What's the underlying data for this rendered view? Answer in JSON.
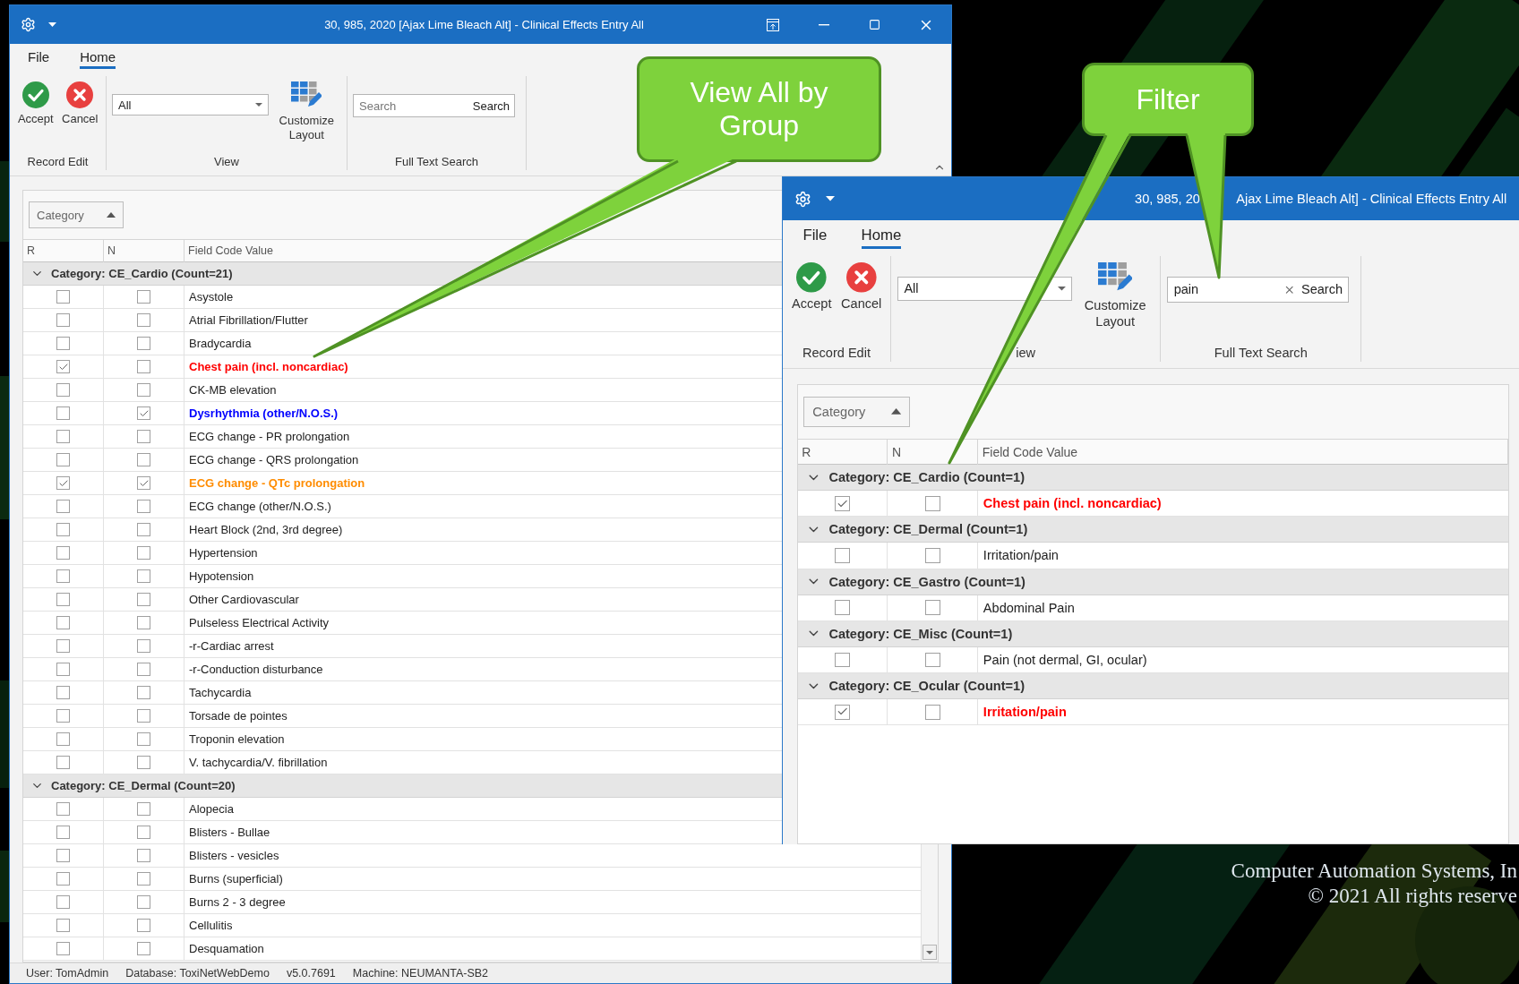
{
  "windows": [
    {
      "title": "30, 985, 2020 [Ajax Lime Bleach Alt] - Clinical Effects Entry All",
      "menu_tabs": [
        {
          "label": "File",
          "selected": false
        },
        {
          "label": "Home",
          "selected": true
        }
      ],
      "ribbon": {
        "record_edit": {
          "buttons": [
            {
              "label": "Accept",
              "kind": "accept"
            },
            {
              "label": "Cancel",
              "kind": "cancel"
            }
          ],
          "group_label": "Record Edit"
        },
        "view": {
          "dropdown_value": "All",
          "button": "Customize Layout",
          "group_label": "View"
        },
        "search": {
          "placeholder": "Search",
          "button": "Search",
          "group_label": "Full Text Search"
        }
      },
      "group_by": "Category",
      "columns": [
        "R",
        "N",
        "Field Code Value"
      ],
      "groups": [
        {
          "label": "Category: CE_Cardio (Count=21)",
          "expanded": true,
          "rows": [
            {
              "r": false,
              "n": false,
              "value": "Asystole"
            },
            {
              "r": false,
              "n": false,
              "value": "Atrial Fibrillation/Flutter"
            },
            {
              "r": false,
              "n": false,
              "value": "Bradycardia"
            },
            {
              "r": true,
              "n": false,
              "value": "Chest pain (incl. noncardiac)",
              "color": "#ff0000"
            },
            {
              "r": false,
              "n": false,
              "value": "CK-MB elevation"
            },
            {
              "r": false,
              "n": true,
              "value": "Dysrhythmia (other/N.O.S.)",
              "color": "#0000ff"
            },
            {
              "r": false,
              "n": false,
              "value": "ECG change - PR prolongation"
            },
            {
              "r": false,
              "n": false,
              "value": "ECG change - QRS prolongation"
            },
            {
              "r": true,
              "n": true,
              "value": "ECG change - QTc prolongation",
              "color": "#ff8c00"
            },
            {
              "r": false,
              "n": false,
              "value": "ECG change (other/N.O.S.)"
            },
            {
              "r": false,
              "n": false,
              "value": "Heart Block (2nd, 3rd degree)"
            },
            {
              "r": false,
              "n": false,
              "value": "Hypertension"
            },
            {
              "r": false,
              "n": false,
              "value": "Hypotension"
            },
            {
              "r": false,
              "n": false,
              "value": "Other Cardiovascular"
            },
            {
              "r": false,
              "n": false,
              "value": "Pulseless Electrical Activity"
            },
            {
              "r": false,
              "n": false,
              "value": "-r-Cardiac arrest"
            },
            {
              "r": false,
              "n": false,
              "value": "-r-Conduction disturbance"
            },
            {
              "r": false,
              "n": false,
              "value": "Tachycardia"
            },
            {
              "r": false,
              "n": false,
              "value": "Torsade de pointes"
            },
            {
              "r": false,
              "n": false,
              "value": "Troponin elevation"
            },
            {
              "r": false,
              "n": false,
              "value": "V. tachycardia/V. fibrillation"
            }
          ]
        },
        {
          "label": "Category: CE_Dermal (Count=20)",
          "expanded": true,
          "rows": [
            {
              "r": false,
              "n": false,
              "value": "Alopecia"
            },
            {
              "r": false,
              "n": false,
              "value": "Blisters - Bullae"
            },
            {
              "r": false,
              "n": false,
              "value": "Blisters - vesicles"
            },
            {
              "r": false,
              "n": false,
              "value": "Burns (superficial)"
            },
            {
              "r": false,
              "n": false,
              "value": "Burns 2 - 3 degree"
            },
            {
              "r": false,
              "n": false,
              "value": "Cellulitis"
            },
            {
              "r": false,
              "n": false,
              "value": "Desquamation"
            }
          ]
        }
      ],
      "status_bar": [
        "User: TomAdmin",
        "Database: ToxiNetWebDemo",
        "v5.0.7691",
        "Machine: NEUMANTA-SB2"
      ]
    },
    {
      "title_parts": [
        "30, 985, 20",
        "Ajax Lime Bleach Alt] - Clinical Effects Entry All"
      ],
      "menu_tabs": [
        {
          "label": "File",
          "selected": false
        },
        {
          "label": "Home",
          "selected": true
        }
      ],
      "ribbon": {
        "record_edit": {
          "buttons": [
            {
              "label": "Accept",
              "kind": "accept"
            },
            {
              "label": "Cancel",
              "kind": "cancel"
            }
          ],
          "group_label": "Record Edit"
        },
        "view": {
          "dropdown_value": "All",
          "button": "Customize Layout",
          "group_label": "iew"
        },
        "search": {
          "value": "pain",
          "button": "Search",
          "group_label": "Full Text Search"
        }
      },
      "group_by": "Category",
      "columns": [
        "R",
        "N",
        "Field Code Value"
      ],
      "groups": [
        {
          "label": "Category: CE_Cardio (Count=1)",
          "expanded": true,
          "rows": [
            {
              "r": true,
              "n": false,
              "value": "Chest pain (incl. noncardiac)",
              "color": "#ff0000"
            }
          ]
        },
        {
          "label": "Category: CE_Dermal (Count=1)",
          "expanded": true,
          "rows": [
            {
              "r": false,
              "n": false,
              "value": "Irritation/pain"
            }
          ]
        },
        {
          "label": "Category: CE_Gastro (Count=1)",
          "expanded": true,
          "rows": [
            {
              "r": false,
              "n": false,
              "value": "Abdominal Pain"
            }
          ]
        },
        {
          "label": "Category: CE_Misc (Count=1)",
          "expanded": true,
          "rows": [
            {
              "r": false,
              "n": false,
              "value": "Pain (not dermal, GI, ocular)"
            }
          ]
        },
        {
          "label": "Category: CE_Ocular (Count=1)",
          "expanded": true,
          "rows": [
            {
              "r": true,
              "n": false,
              "value": "Irritation/pain",
              "color": "#ff0000"
            }
          ]
        }
      ]
    }
  ],
  "callouts": [
    {
      "text": "View All by Group"
    },
    {
      "text": "Filter"
    }
  ],
  "desktop": {
    "caption_lines": [
      "Computer Automation Systems, In",
      "© 2021 All rights reserve"
    ]
  }
}
